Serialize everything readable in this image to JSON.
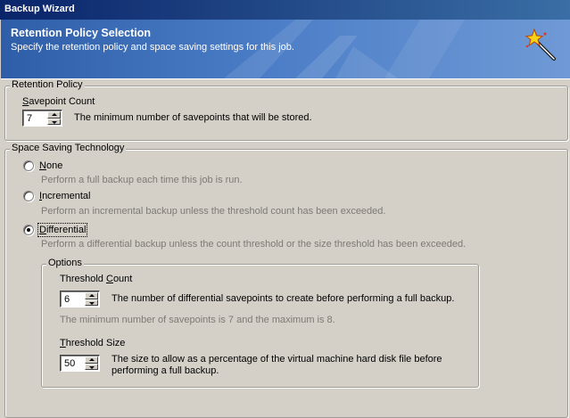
{
  "window": {
    "title": "Backup Wizard"
  },
  "banner": {
    "heading": "Retention Policy Selection",
    "subtitle": "Specify the retention policy and space saving settings for this job.",
    "icon": "magic-wand-icon"
  },
  "retention": {
    "legend": "Retention Policy",
    "savepoint_label_hotkey": "S",
    "savepoint_label_rest": "avepoint Count",
    "savepoint_value": "7",
    "savepoint_desc": "The minimum number of savepoints that will be stored."
  },
  "space": {
    "legend": "Space Saving Technology",
    "options": [
      {
        "hotkey": "N",
        "rest": "one",
        "desc": "Perform a full backup each time this job is run.",
        "selected": false
      },
      {
        "hotkey": "I",
        "rest": "ncremental",
        "desc": "Perform an incremental backup unless the threshold count has been exceeded.",
        "selected": false
      },
      {
        "hotkey": "D",
        "rest": "ifferential",
        "desc": "Perform a differential backup unless the count threshold or the size threshold has been exceeded.",
        "selected": true
      }
    ]
  },
  "options": {
    "legend": "Options",
    "threshold_count_label_pre": "Threshold ",
    "threshold_count_hotkey": "C",
    "threshold_count_label_post": "ount",
    "threshold_count_value": "6",
    "threshold_count_desc": "The number of differential savepoints to create before performing a full backup.",
    "threshold_count_note": "The minimum number of savepoints is 7 and the maximum is 8.",
    "threshold_size_hotkey": "T",
    "threshold_size_label_rest": "hreshold Size",
    "threshold_size_value": "50",
    "threshold_size_desc_line1": "The size to allow as a percentage of the virtual machine hard disk file before",
    "threshold_size_desc_line2": "performing a full backup."
  },
  "colors": {
    "title_bar": "#0a246a",
    "banner": "#4a7cc6",
    "dialog_bg": "#d4d0c8",
    "disabled_text": "#7d7a74"
  }
}
